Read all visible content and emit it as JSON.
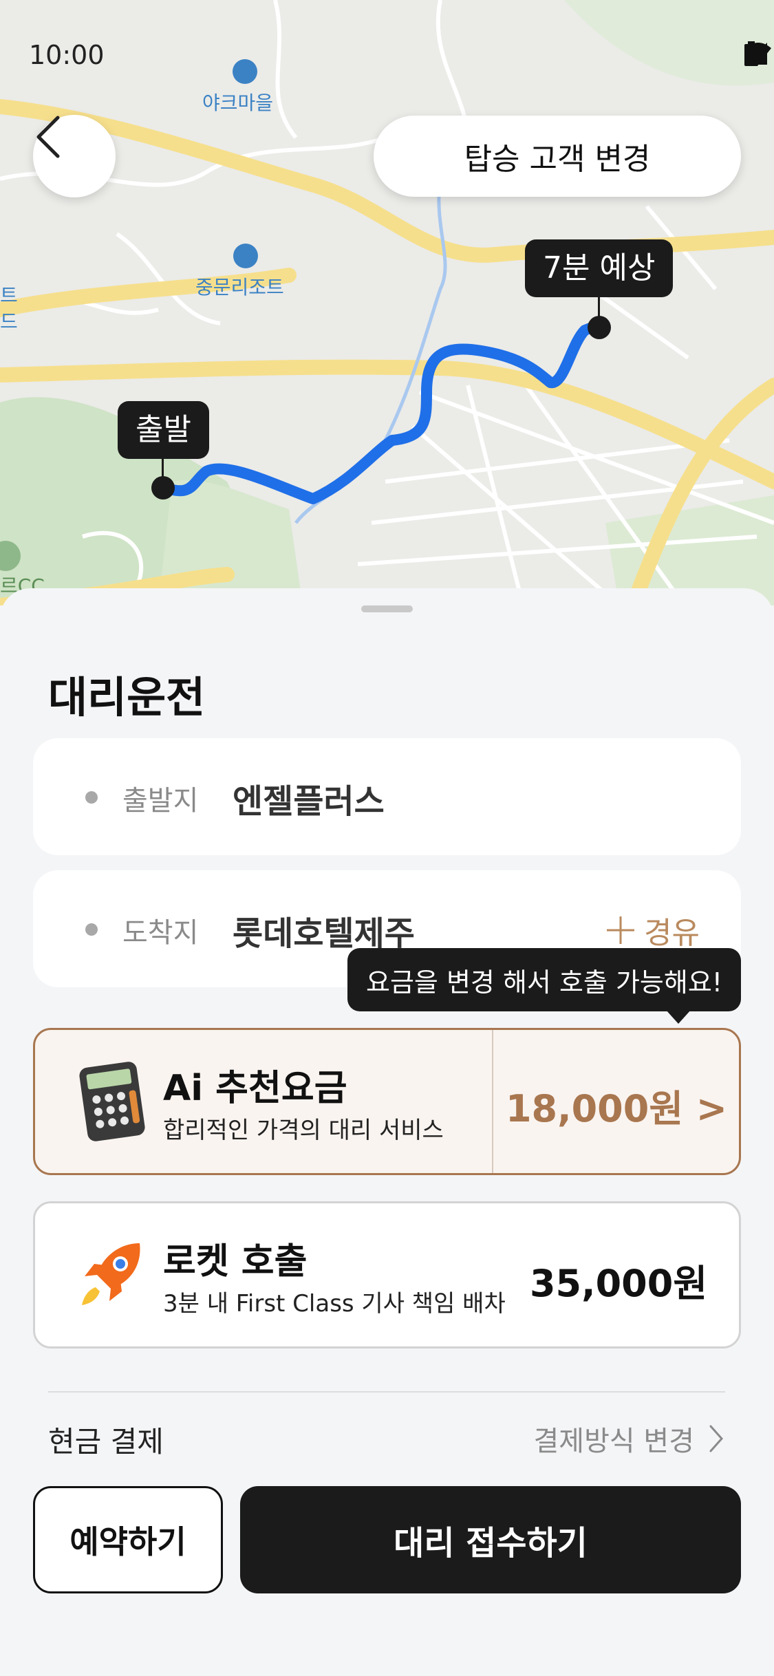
{
  "status_bar": {
    "time": "10:00"
  },
  "header": {
    "back_icon": "chevron-left-icon",
    "change_passenger_label": "탑승 고객 변경"
  },
  "map": {
    "place_labels": [
      "야크마을",
      "중문리조트",
      "트",
      "드",
      "르CC"
    ],
    "start_tag": "출발",
    "eta_tag": "7분 예상",
    "route_color": "#1f6fe8"
  },
  "sheet": {
    "title": "대리운전",
    "origin": {
      "label": "출발지",
      "value": "엔젤플러스"
    },
    "destination": {
      "label": "도착지",
      "value": "롯데호텔제주",
      "via_label": "경유"
    },
    "tooltip": "요금을 변경 해서 호출 가능해요!",
    "fares": [
      {
        "name": "Ai 추천요금",
        "desc": "합리적인 가격의 대리 서비스",
        "price": "18,000원 >",
        "icon": "calculator-icon",
        "selected": true,
        "accent": "#a8764f"
      },
      {
        "name": "로켓 호출",
        "desc": "3분 내 First Class 기사 책임 배차",
        "price": "35,000원",
        "icon": "rocket-icon",
        "selected": false
      }
    ],
    "payment": {
      "method": "현금 결제",
      "change_label": "결제방식 변경"
    },
    "buttons": {
      "reserve": "예약하기",
      "submit": "대리 접수하기"
    }
  }
}
